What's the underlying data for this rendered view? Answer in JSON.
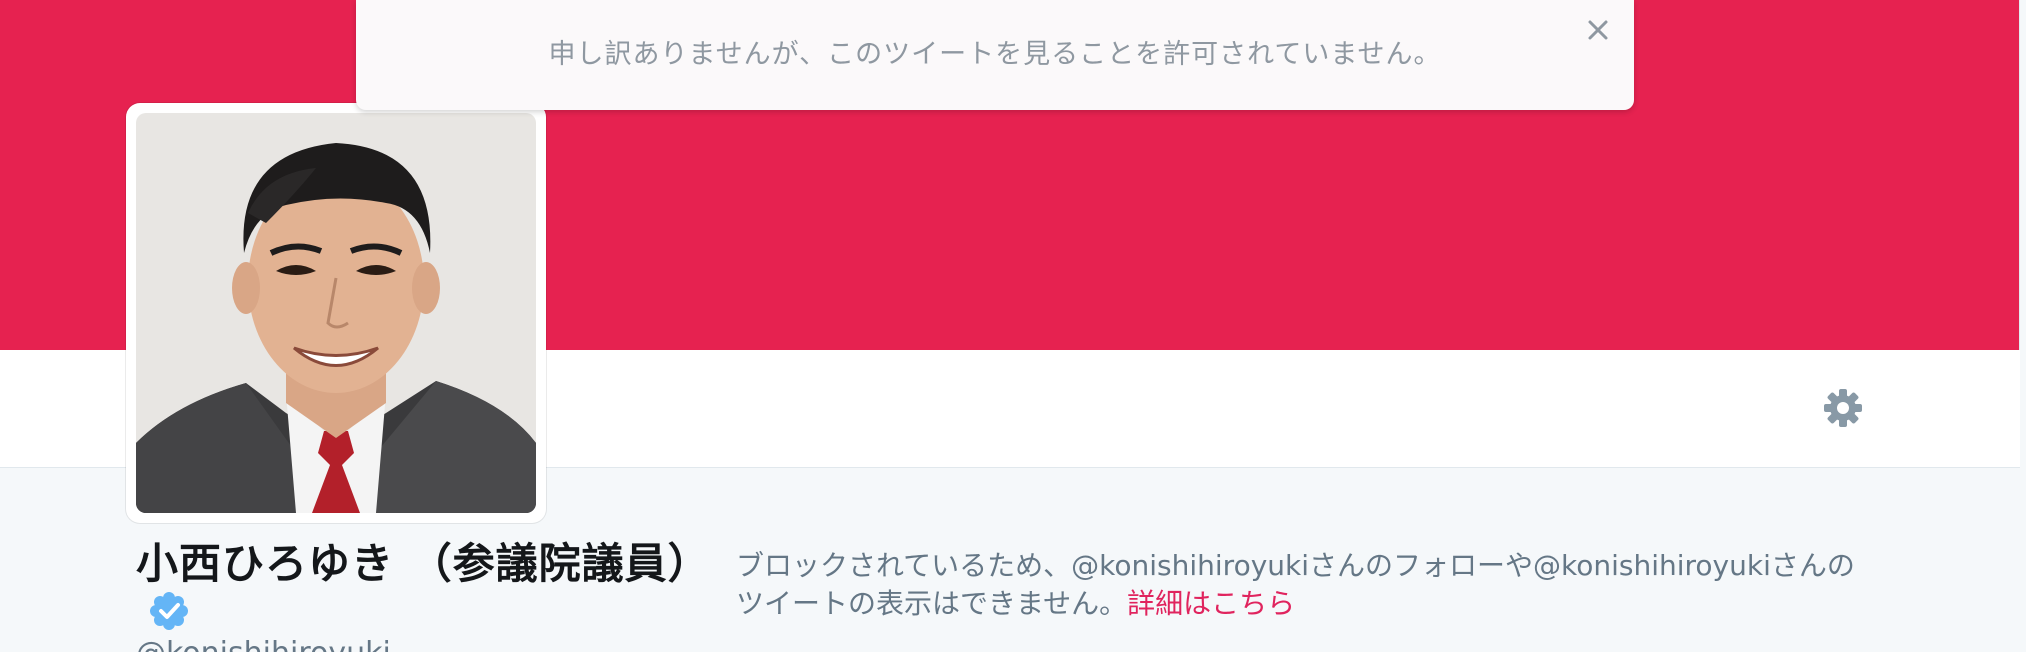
{
  "alert": {
    "message": "申し訳ありませんが、このツイートを見ることを許可されていません。",
    "close_icon": "close-icon"
  },
  "header": {
    "banner_color": "#e62250",
    "settings_icon": "gear-icon"
  },
  "profile": {
    "name": "小西ひろゆき （参議院議員）",
    "verified_icon": "verified-badge-icon",
    "handle": "@konishihiroyuki"
  },
  "blocked": {
    "message": "ブロックされているため、@konishihiroyukiさんのフォローや@konishihiroyukiさんのツイートの表示はできません。",
    "link_text": "詳細はこちら",
    "link_color": "#e0245e"
  }
}
